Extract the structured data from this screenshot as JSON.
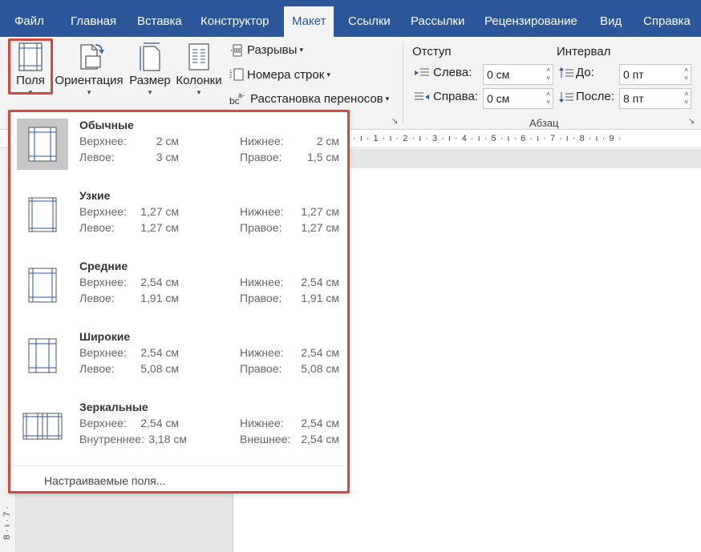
{
  "tabs": [
    {
      "label": "Файл"
    },
    {
      "label": "Главная"
    },
    {
      "label": "Вставка"
    },
    {
      "label": "Конструктор"
    },
    {
      "label": "Макет"
    },
    {
      "label": "Ссылки"
    },
    {
      "label": "Рассылки"
    },
    {
      "label": "Рецензирование"
    },
    {
      "label": "Вид"
    },
    {
      "label": "Справка"
    }
  ],
  "ribbon": {
    "margins_label": "Поля",
    "orientation_label": "Ориентация",
    "size_label": "Размер",
    "columns_label": "Колонки",
    "breaks_label": "Разрывы",
    "line_numbers_label": "Номера строк",
    "hyphenation_label": "Расстановка переносов",
    "indent_label": "Отступ",
    "spacing_label": "Интервал",
    "left_label": "Слева:",
    "right_label": "Справа:",
    "before_label": "До:",
    "after_label": "После:",
    "left_value": "0 см",
    "right_value": "0 см",
    "before_value": "0 пт",
    "after_value": "8 пт",
    "paragraph_group_label": "Абзац"
  },
  "ruler_text": "· ı · 1 · ı · 2 · ı · 3 · ı · 4 · ı · 5 · ı · 6 · ı · 7 · ı · 8 · ı · 9 ·",
  "vruler_text": "8 · ı · 7 ·",
  "margins_menu": {
    "options": [
      {
        "name": "Обычные",
        "k1": "Верхнее:",
        "v1": "2 см",
        "k2": "Нижнее:",
        "v2": "2 см",
        "k3": "Левое:",
        "v3": "3 см",
        "k4": "Правое:",
        "v4": "1,5 см"
      },
      {
        "name": "Узкие",
        "k1": "Верхнее:",
        "v1": "1,27 см",
        "k2": "Нижнее:",
        "v2": "1,27 см",
        "k3": "Левое:",
        "v3": "1,27 см",
        "k4": "Правое:",
        "v4": "1,27 см"
      },
      {
        "name": "Средние",
        "k1": "Верхнее:",
        "v1": "2,54 см",
        "k2": "Нижнее:",
        "v2": "2,54 см",
        "k3": "Левое:",
        "v3": "1,91 см",
        "k4": "Правое:",
        "v4": "1,91 см"
      },
      {
        "name": "Широкие",
        "k1": "Верхнее:",
        "v1": "2,54 см",
        "k2": "Нижнее:",
        "v2": "2,54 см",
        "k3": "Левое:",
        "v3": "5,08 см",
        "k4": "Правое:",
        "v4": "5,08 см"
      },
      {
        "name": "Зеркальные",
        "k1": "Верхнее:",
        "v1": "2,54 см",
        "k2": "Нижнее:",
        "v2": "2,54 см",
        "k3": "Внутреннее:",
        "v3": "3,18 см",
        "k4": "Внешнее:",
        "v4": "2,54 см"
      }
    ],
    "custom_label": "Настраиваемые поля..."
  }
}
